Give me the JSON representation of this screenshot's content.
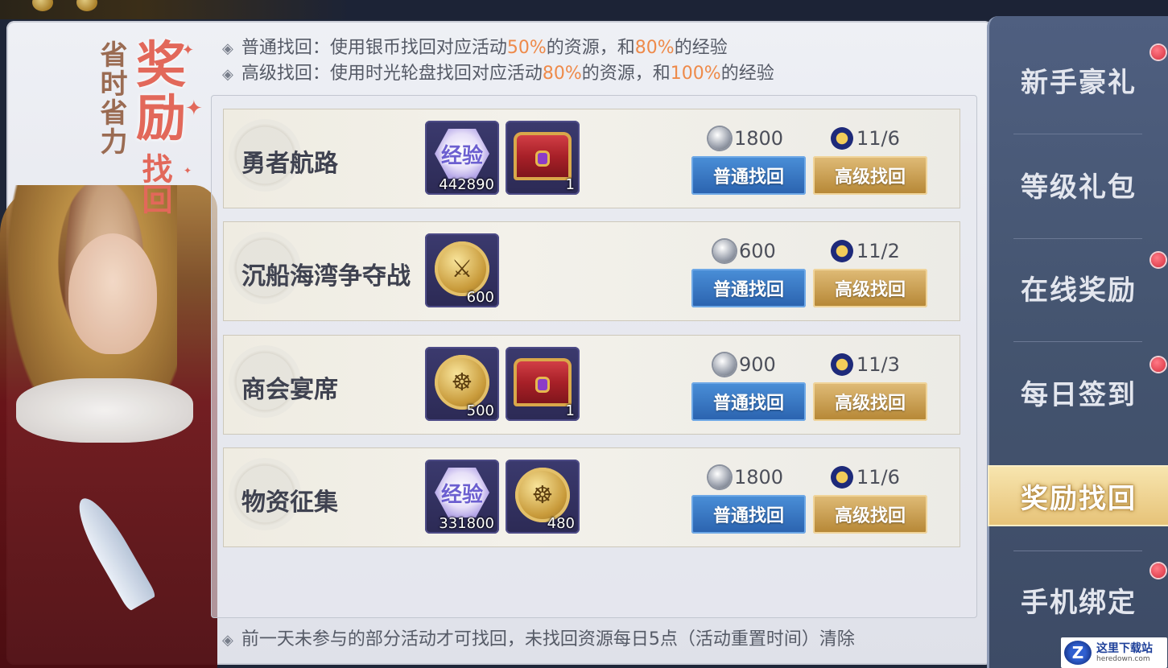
{
  "header": {
    "title_big": "奖励",
    "title_small": "找回",
    "slogan": "省时省力"
  },
  "info_lines": [
    {
      "prefix": "普通找回：使用银币找回对应活动",
      "pct1": "50%",
      "mid": "的资源，和",
      "pct2": "80%",
      "suffix": "的经验"
    },
    {
      "prefix": "高级找回：使用时光轮盘找回对应活动",
      "pct1": "80%",
      "mid": "的资源，和",
      "pct2": "100%",
      "suffix": "的经验"
    }
  ],
  "labels": {
    "normal_button": "普通找回",
    "advanced_button": "高级找回",
    "exp_text": "经验"
  },
  "activities": [
    {
      "name": "勇者航路",
      "items": [
        {
          "type": "exp",
          "qty": "442890"
        },
        {
          "type": "chest",
          "qty": "1"
        }
      ],
      "silver_cost": "1800",
      "wheel_cost": "11/6"
    },
    {
      "name": "沉船海湾争夺战",
      "items": [
        {
          "type": "sword-coin",
          "qty": "600"
        }
      ],
      "silver_cost": "600",
      "wheel_cost": "11/2"
    },
    {
      "name": "商会宴席",
      "items": [
        {
          "type": "gold-coin",
          "qty": "500"
        },
        {
          "type": "chest",
          "qty": "1"
        }
      ],
      "silver_cost": "900",
      "wheel_cost": "11/3"
    },
    {
      "name": "物资征集",
      "items": [
        {
          "type": "exp",
          "qty": "331800"
        },
        {
          "type": "gold-coin",
          "qty": "480"
        }
      ],
      "silver_cost": "1800",
      "wheel_cost": "11/6"
    }
  ],
  "footer_note": "前一天未参与的部分活动才可找回，未找回资源每日5点（活动重置时间）清除",
  "nav": {
    "items": [
      {
        "label": "新手豪礼",
        "badge": true
      },
      {
        "label": "等级礼包",
        "badge": false
      },
      {
        "label": "在线奖励",
        "badge": true
      },
      {
        "label": "每日签到",
        "badge": true
      },
      {
        "label": "奖励找回",
        "badge": false,
        "active": true
      },
      {
        "label": "手机绑定",
        "badge": true
      }
    ]
  },
  "watermark": {
    "site": "这里下载站",
    "url": "heredown.com",
    "logo": "Z"
  },
  "colors": {
    "highlight": "#ee8a4a",
    "title": "#e2685a",
    "normal_btn": "#2a62ae",
    "adv_btn": "#b58634"
  }
}
